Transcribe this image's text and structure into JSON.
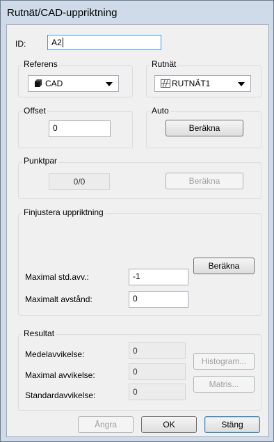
{
  "window": {
    "title": "Rutnät/CAD-uppriktning"
  },
  "id_field": {
    "label": "ID:",
    "value": "A2"
  },
  "referens": {
    "title": "Referens",
    "icon": "cube-icon",
    "selected": "CAD"
  },
  "rutnat": {
    "title": "Rutnät",
    "icon": "grid-icon",
    "selected": "RUTNÄT1"
  },
  "offset": {
    "title": "Offset",
    "value": "0"
  },
  "auto": {
    "title": "Auto",
    "button": "Beräkna"
  },
  "punktpar": {
    "title": "Punktpar",
    "value": "0/0",
    "button": "Beräkna"
  },
  "finjustera": {
    "title": "Finjustera uppriktning",
    "button": "Beräkna",
    "max_std_label": "Maximal std.avv.:",
    "max_std_value": "-1",
    "max_dist_label": "Maximalt avstånd:",
    "max_dist_value": "0"
  },
  "resultat": {
    "title": "Resultat",
    "medel_label": "Medelavvikelse:",
    "medel_value": "0",
    "maxavv_label": "Maximal avvikelse:",
    "maxavv_value": "0",
    "std_label": "Standardavvikelse:",
    "std_value": "0",
    "histogram_button": "Histogram...",
    "matris_button": "Matris..."
  },
  "footer": {
    "undo": "Ångra",
    "ok": "OK",
    "close": "Stäng"
  },
  "colors": {
    "frame": "#cfdbe9",
    "client": "#f0f0f0",
    "focus_border": "#3399ff"
  }
}
